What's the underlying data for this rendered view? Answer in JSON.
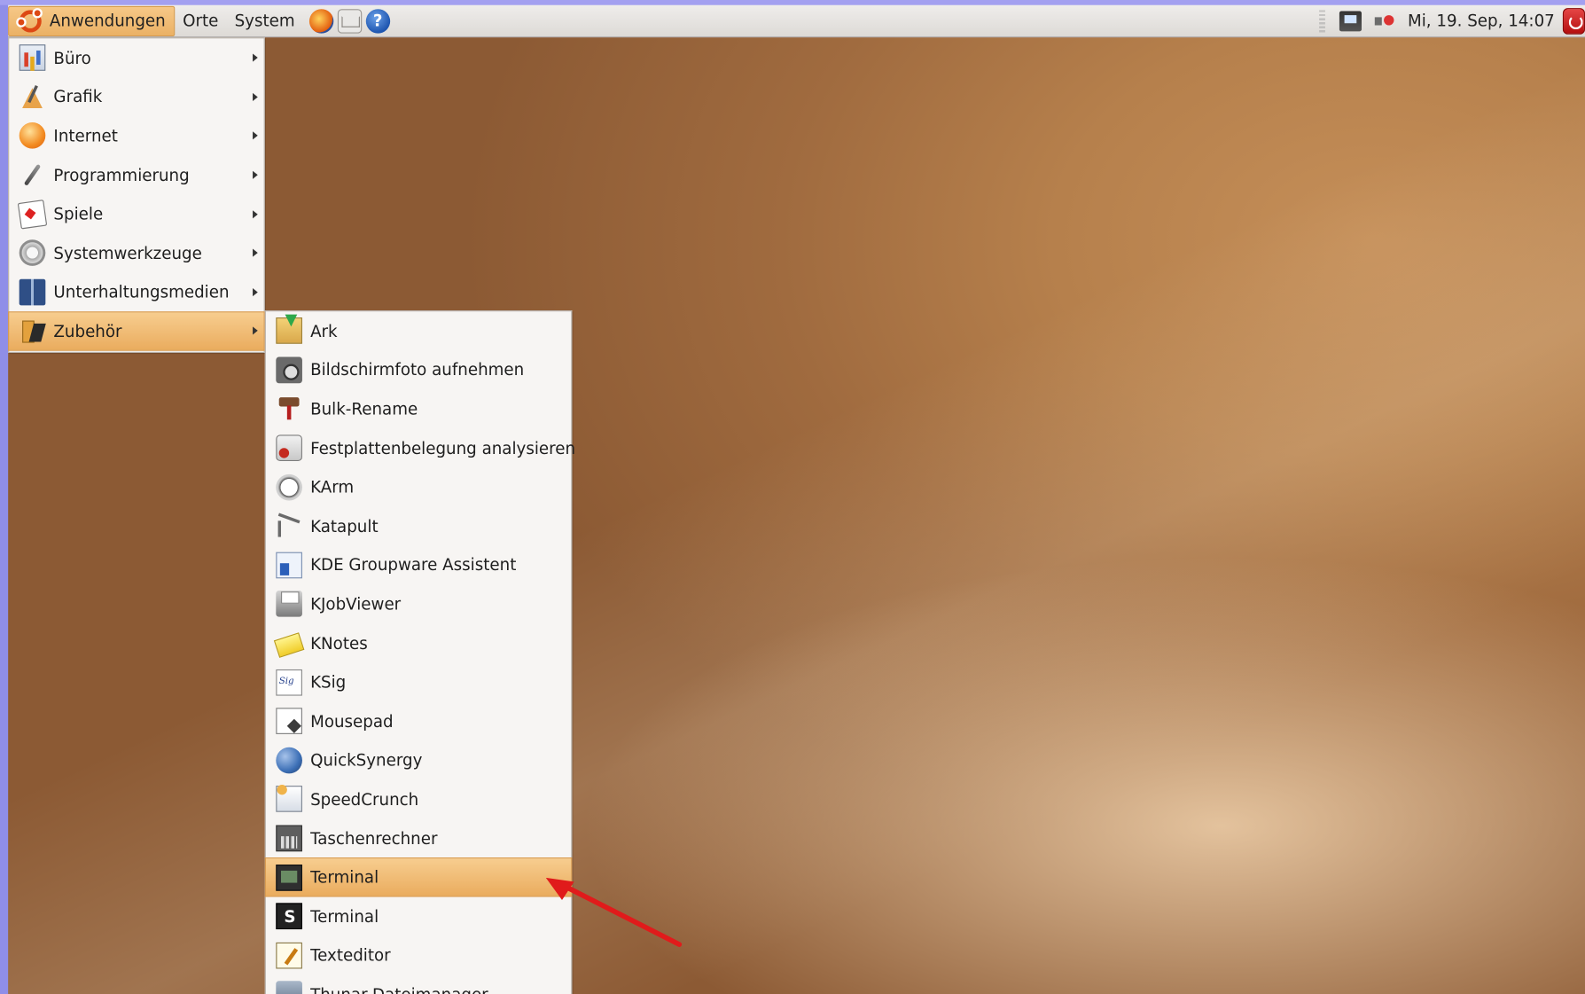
{
  "panel": {
    "applications_label": "Anwendungen",
    "places_label": "Orte",
    "system_label": "System",
    "clock": "Mi, 19. Sep, 14:07",
    "launchers": [
      "firefox-icon",
      "mail-icon",
      "help-icon"
    ],
    "help_glyph": "?"
  },
  "main_menu": {
    "items": [
      {
        "label": "Büro",
        "icon": "office-icon"
      },
      {
        "label": "Grafik",
        "icon": "graphics-icon"
      },
      {
        "label": "Internet",
        "icon": "internet-icon"
      },
      {
        "label": "Programmierung",
        "icon": "programming-icon"
      },
      {
        "label": "Spiele",
        "icon": "games-icon"
      },
      {
        "label": "Systemwerkzeuge",
        "icon": "system-tools-icon"
      },
      {
        "label": "Unterhaltungsmedien",
        "icon": "multimedia-icon"
      },
      {
        "label": "Zubehör",
        "icon": "accessories-icon",
        "selected": true
      }
    ]
  },
  "sub_menu": {
    "items": [
      {
        "label": "Ark",
        "icon": "archive-icon"
      },
      {
        "label": "Bildschirmfoto aufnehmen",
        "icon": "camera-icon"
      },
      {
        "label": "Bulk-Rename",
        "icon": "rename-icon"
      },
      {
        "label": "Festplattenbelegung analysieren",
        "icon": "disk-icon"
      },
      {
        "label": "KArm",
        "icon": "clock-icon"
      },
      {
        "label": "Katapult",
        "icon": "catapult-icon"
      },
      {
        "label": "KDE Groupware Assistent",
        "icon": "groupware-icon"
      },
      {
        "label": "KJobViewer",
        "icon": "printer-icon"
      },
      {
        "label": "KNotes",
        "icon": "note-icon"
      },
      {
        "label": "KSig",
        "icon": "signature-icon"
      },
      {
        "label": "Mousepad",
        "icon": "text-document-icon"
      },
      {
        "label": "QuickSynergy",
        "icon": "synergy-icon"
      },
      {
        "label": "SpeedCrunch",
        "icon": "speedcrunch-icon"
      },
      {
        "label": "Taschenrechner",
        "icon": "calculator-icon"
      },
      {
        "label": "Terminal",
        "icon": "terminal-icon",
        "selected": true
      },
      {
        "label": "Terminal",
        "icon": "terminal-s-icon"
      },
      {
        "label": "Texteditor",
        "icon": "text-editor-icon"
      },
      {
        "label": "Thunar-Dateimanager",
        "icon": "file-manager-icon"
      }
    ]
  },
  "colors": {
    "selection": "#eaac5e",
    "annotation_arrow": "#e01b1b",
    "frame": "#8e8ee6"
  }
}
